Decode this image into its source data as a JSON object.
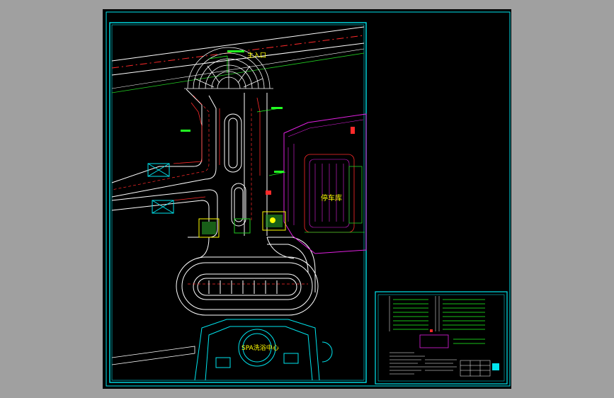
{
  "drawing": {
    "main_entrance_label": "主入口",
    "parking_label": "停车库",
    "spa_label": "SPA洗浴中心"
  },
  "colors": {
    "sheet_background": "#000000",
    "frame": "#00e5ee",
    "road_edge": "#ffffff",
    "road_centerline": "#ff2a2a",
    "greenery_line": "#22cc22",
    "parking_outline": "#e020e0",
    "text_yellow": "#ffff00",
    "text_green": "#22ff22"
  }
}
